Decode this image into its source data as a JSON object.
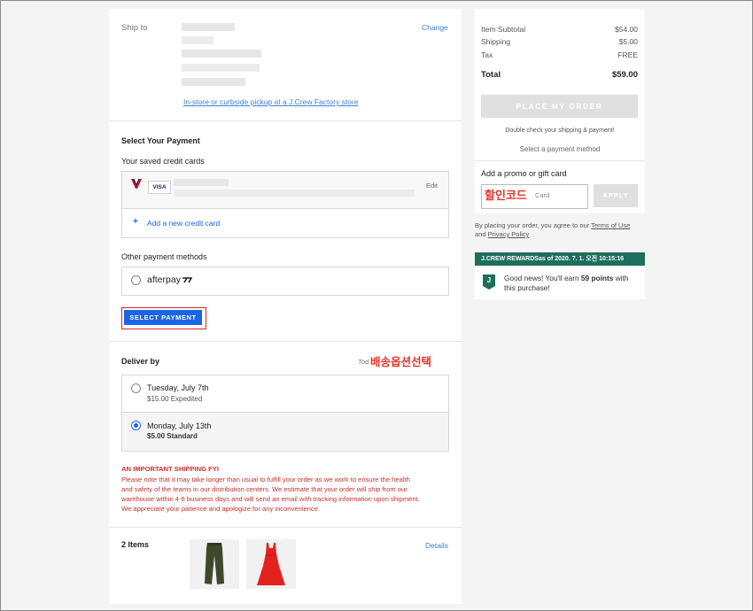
{
  "ship_to": {
    "label": "Ship to",
    "change_link": "Change",
    "pickup_link": "In-store or curbside pickup at a J.Crew Factory store"
  },
  "payment": {
    "title": "Select Your Payment",
    "saved_cards_label": "Your saved credit cards",
    "card_brand": "VISA",
    "edit_link": "Edit",
    "add_card_plus": "+",
    "add_card_link": "Add a new credit card",
    "other_methods_label": "Other payment methods",
    "afterpay_label": "afterpay",
    "select_button": "SELECT PAYMENT"
  },
  "deliver": {
    "title": "Deliver by",
    "header_right": "Tod",
    "options": [
      {
        "date": "Tuesday, July 7th",
        "price_method": "$15.00 Expedited",
        "selected": false
      },
      {
        "date": "Monday, July 13th",
        "price_method": "$5.00 Standard",
        "selected": true
      }
    ],
    "notice_title": "AN IMPORTANT SHIPPING FYI",
    "notice_lines": [
      "Please note that it may take longer than usual to fulfill your order as we work to ensure the health",
      "and safety of the teams in our distribution centers. We estimate that your order will ship from our",
      "warehouse within 4-6 business days and will send an email with tracking information upon shipment.",
      "We appreciate your patience and apologize for any inconvenience."
    ]
  },
  "items": {
    "count_label": "2 Items",
    "details_link": "Details"
  },
  "summary": {
    "subtotal_label": "Item Subtotal",
    "subtotal_value": "$54.00",
    "shipping_label": "Shipping",
    "shipping_value": "$5.00",
    "tax_label": "Tax",
    "tax_value": "FREE",
    "total_label": "Total",
    "total_value": "$59.00",
    "place_order_button": "PLACE MY ORDER",
    "check_note": "Double check your shipping & payment!",
    "select_note": "Select a payment method",
    "promo_label": "Add a promo or gift card",
    "promo_placeholder": "Card",
    "apply_button": "APPLY"
  },
  "terms": {
    "prefix": "By placing your order, you agree to our ",
    "terms_link": "Terms of Use",
    "and": "and ",
    "privacy_link": "Privacy Policy"
  },
  "rewards": {
    "header_left": "J.CREW REWARDS",
    "header_right": "as of 2020. 7. 1. 오전 10:15:16",
    "badge_letter": "J",
    "msg_part1": "Good news! You'll earn ",
    "msg_points": "59 points",
    "msg_part2": " with",
    "msg_line2": "this purchase!"
  },
  "annotations": {
    "promo_note": "할인코드",
    "shipping_note": "배송옵션선택"
  },
  "colors": {
    "accent_blue": "#1a64e8",
    "rewards_green": "#1e6e5c",
    "warning_red": "#c9302c"
  }
}
